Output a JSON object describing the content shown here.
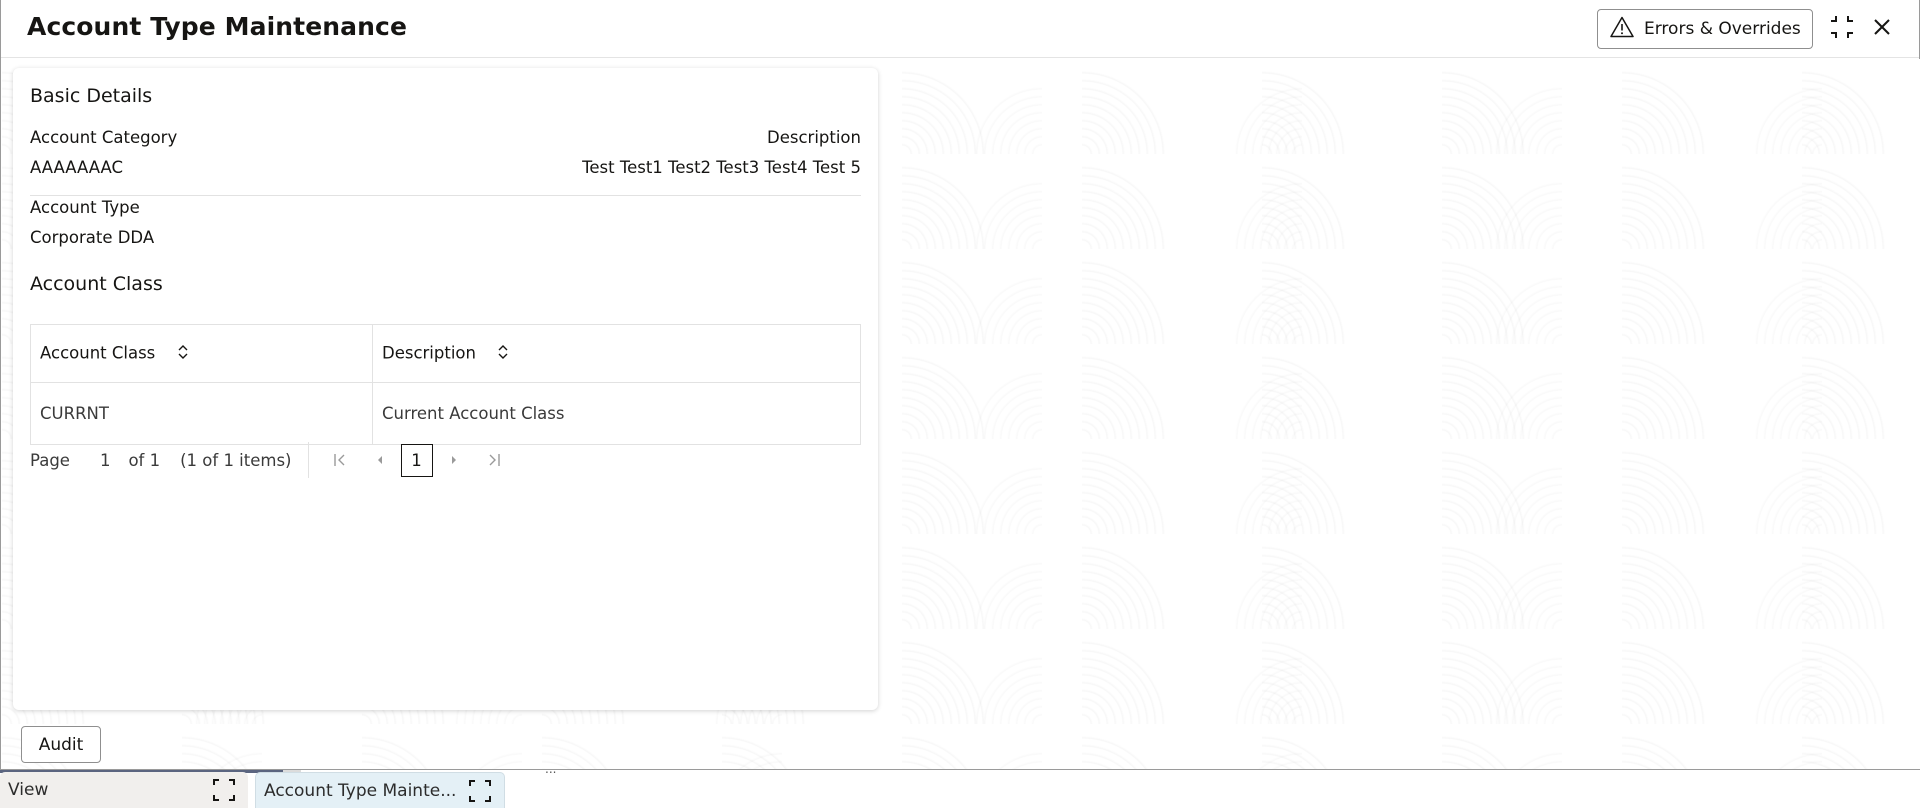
{
  "window": {
    "title": "Account Type Maintenance",
    "errors_button_label": "Errors & Overrides",
    "icons": {
      "warning": "warning-triangle-icon",
      "restore": "compress-icon",
      "close": "close-icon"
    }
  },
  "basic_details": {
    "section_title": "Basic Details",
    "account_category": {
      "label": "Account Category",
      "value": "AAAAAAAC"
    },
    "description": {
      "label": "Description",
      "value": "Test Test1 Test2 Test3 Test4 Test 5"
    },
    "account_type": {
      "label": "Account Type",
      "value": "Corporate DDA"
    }
  },
  "account_class": {
    "section_title": "Account Class",
    "columns": [
      "Account Class",
      "Description"
    ],
    "rows": [
      {
        "account_class": "CURRNT",
        "description": "Current Account Class"
      }
    ]
  },
  "pagination": {
    "page_label": "Page",
    "current_page": "1",
    "of_label": "of 1",
    "items_label": "(1 of 1 items)",
    "current_page_button": "1"
  },
  "footer": {
    "audit_label": "Audit"
  },
  "taskbar": {
    "tabs": [
      {
        "label": "View",
        "active": false
      },
      {
        "label": "Account Type Mainte...",
        "active": true
      }
    ],
    "overflow": "..."
  }
}
